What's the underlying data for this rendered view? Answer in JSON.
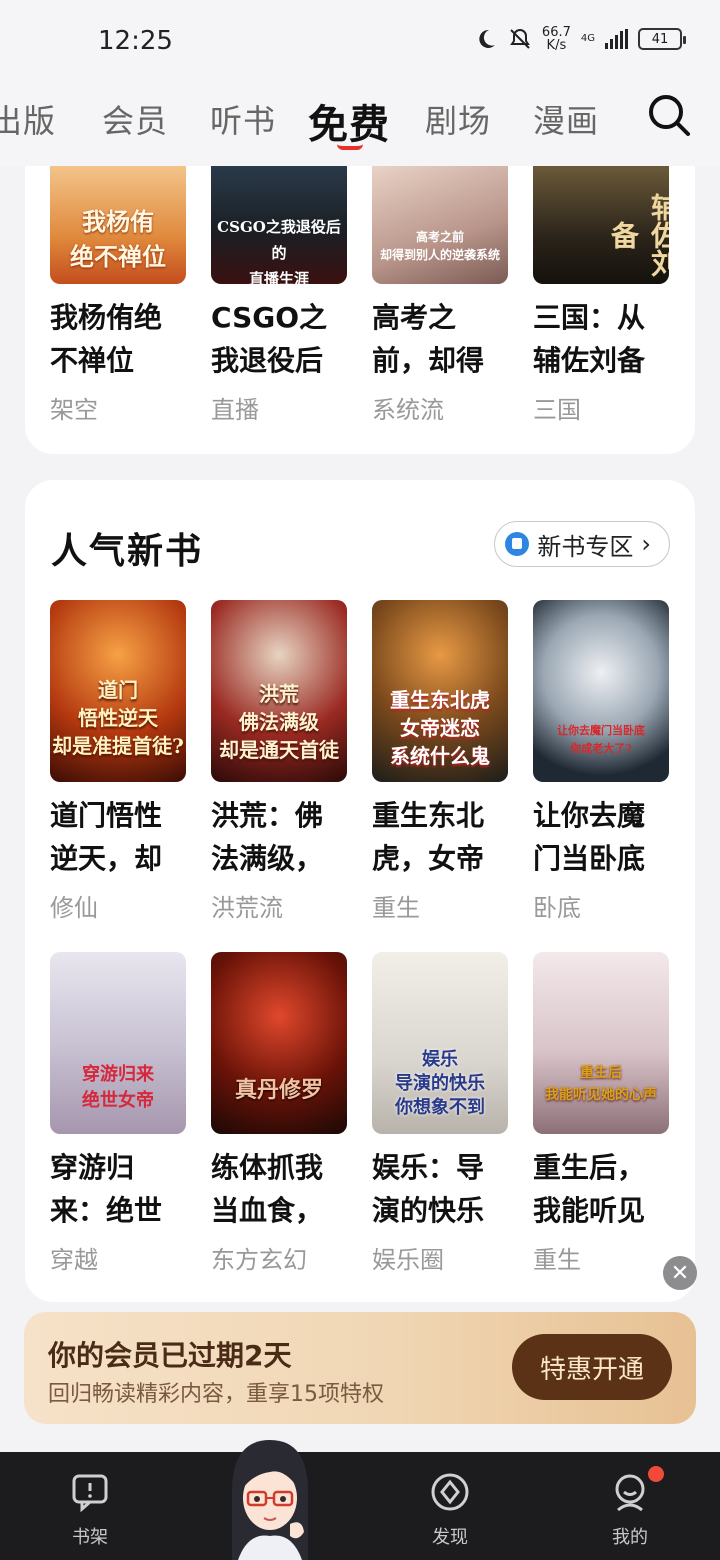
{
  "status_bar": {
    "time": "12:25",
    "net_speed": "66.7",
    "net_unit": "K/s",
    "net_type": "4G",
    "battery": "41"
  },
  "nav": {
    "tabs": [
      {
        "label": "出版",
        "active": false
      },
      {
        "label": "会员",
        "active": false
      },
      {
        "label": "听书",
        "active": false
      },
      {
        "label": "免费",
        "active": true
      },
      {
        "label": "剧场",
        "active": false
      },
      {
        "label": "漫画",
        "active": false
      }
    ]
  },
  "top_books": [
    {
      "title": "我杨侑绝不禅位",
      "tag": "架空",
      "cover_text": "我杨侑\n绝不禅位"
    },
    {
      "title": "CSGO之我退役后的直播生涯",
      "tag": "直播",
      "cover_text": "CSGO之我退役后的\n直播生涯"
    },
    {
      "title": "高考之前，却得到别人的逆袭系统",
      "tag": "系统流",
      "cover_text": "高考之前\n却得到别人的逆袭系统"
    },
    {
      "title": "三国：从辅佐刘备",
      "tag": "三国",
      "cover_text": "辅佐刘备"
    }
  ],
  "new_books_section": {
    "title": "人气新书",
    "zone_button": "新书专区",
    "books": [
      {
        "title": "道门悟性逆天，却是准提首徒?",
        "tag": "修仙",
        "cover_text": "道门\n悟性逆天\n却是准提首徒?"
      },
      {
        "title": "洪荒：佛法满级，却是通天首徒",
        "tag": "洪荒流",
        "cover_text": "洪荒\n佛法满级\n却是通天首徒"
      },
      {
        "title": "重生东北虎，女帝迷恋系统什么鬼",
        "tag": "重生",
        "cover_text": "重生东北虎\n女帝迷恋\n系统什么鬼"
      },
      {
        "title": "让你去魔门当卧底你成老大了?",
        "tag": "卧底",
        "cover_text": "让你去魔门当卧底\n你成老大了?"
      },
      {
        "title": "穿游归来：绝世女帝成了我老婆",
        "tag": "穿越",
        "cover_text": "穿游归来\n绝世女帝"
      },
      {
        "title": "练体抓我当血食，可在下真丹修罗",
        "tag": "东方玄幻",
        "cover_text": "真丹修罗"
      },
      {
        "title": "娱乐：导演的快乐你想象不到",
        "tag": "娱乐圈",
        "cover_text": "娱乐\n导演的快乐\n你想象不到"
      },
      {
        "title": "重生后，我能听见她的心声",
        "tag": "重生",
        "cover_text": "重生后\n我能听见她的心声"
      }
    ]
  },
  "member_banner": {
    "title": "你的会员已过期2天",
    "subtitle": "回归畅读精彩内容，重享15项特权",
    "button": "特惠开通"
  },
  "bottom_nav": {
    "items": [
      {
        "label": "书架"
      },
      {
        "label": "发现"
      },
      {
        "label": "我的"
      }
    ]
  }
}
